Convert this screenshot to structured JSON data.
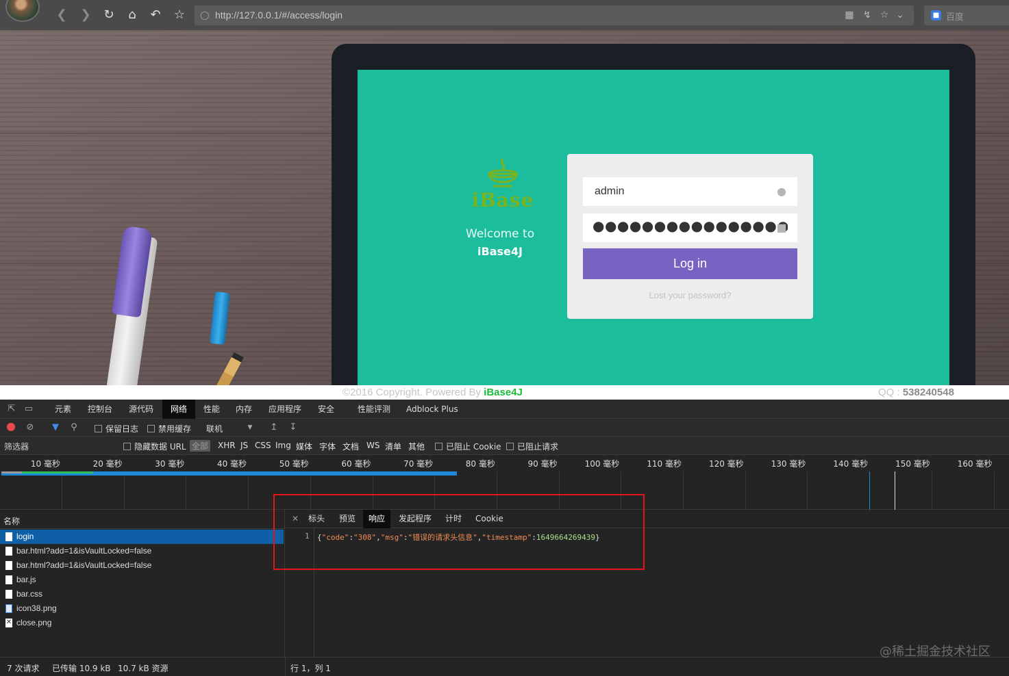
{
  "browser": {
    "url": "http://127.0.0.1/#/access/login",
    "search_placeholder": "百度",
    "icons": [
      "back-icon",
      "forward-icon",
      "reload-icon",
      "home-icon",
      "undo-icon",
      "star-icon",
      "shield-icon",
      "qr-code-icon",
      "lightning-icon",
      "star-icon",
      "chevron-down-icon",
      "baidu-icon"
    ]
  },
  "page": {
    "brand_wordmark": "iBase",
    "welcome_text": "Welcome to",
    "welcome_brand": "iBase4J",
    "login": {
      "username": "admin",
      "password_mask": "●●●●●●●●●●●●●●●●●●●●●●●●●●●●●●",
      "login_button": "Log in",
      "lost_password": "Lost your password?"
    },
    "footer": {
      "copyright": "©2016 Copyright. Powered By ",
      "copyright_brand": "iBase4J",
      "qq_label": "QQ : ",
      "qq_number": "538240548"
    },
    "colors": {
      "screen": "#1bbd9c",
      "login_button": "#7763c2",
      "brand_green": "#7ab320"
    }
  },
  "devtools": {
    "tabs": [
      "元素",
      "控制台",
      "源代码",
      "网络",
      "性能",
      "内存",
      "应用程序",
      "安全",
      "性能评测",
      "Adblock Plus"
    ],
    "active_tab": "网络",
    "controls": {
      "preserve_log": "保留日志",
      "disable_cache": "禁用缓存",
      "throttle": "联机"
    },
    "filters": {
      "label": "筛选器",
      "hide_data_url": "隐藏数据 URL",
      "all": "全部",
      "types": [
        "XHR",
        "JS",
        "CSS",
        "Img",
        "媒体",
        "字体",
        "文档",
        "WS",
        "清单",
        "其他"
      ],
      "blocked_cookies": "已阻止 Cookie",
      "blocked_requests": "已阻止请求"
    },
    "timeline_ticks": [
      "10 毫秒",
      "20 毫秒",
      "30 毫秒",
      "40 毫秒",
      "50 毫秒",
      "60 毫秒",
      "70 毫秒",
      "80 毫秒",
      "90 毫秒",
      "100 毫秒",
      "110 毫秒",
      "120 毫秒",
      "130 毫秒",
      "140 毫秒",
      "150 毫秒",
      "160 毫秒"
    ],
    "requests_header": "名称",
    "requests": [
      {
        "name": "login",
        "type": "doc"
      },
      {
        "name": "bar.html?add=1&isVaultLocked=false",
        "type": "doc"
      },
      {
        "name": "bar.html?add=1&isVaultLocked=false",
        "type": "doc"
      },
      {
        "name": "bar.js",
        "type": "doc"
      },
      {
        "name": "bar.css",
        "type": "doc"
      },
      {
        "name": "icon38.png",
        "type": "img"
      },
      {
        "name": "close.png",
        "type": "broken"
      }
    ],
    "response_tabs": [
      "标头",
      "预览",
      "响应",
      "发起程序",
      "计时",
      "Cookie"
    ],
    "active_response_tab": "响应",
    "response": {
      "line_number": "1",
      "code_key": "\"code\"",
      "code_val": "\"308\"",
      "msg_key": "\"msg\"",
      "msg_val": "\"错误的请求头信息\"",
      "ts_key": "\"timestamp\"",
      "ts_val": "1649664269439"
    },
    "status": {
      "requests": "7 次请求",
      "transferred": "已传输 10.9 kB",
      "resources": "10.7 kB 资源",
      "cursor": "行 1，列 1"
    }
  },
  "watermark": "@稀土掘金技术社区"
}
